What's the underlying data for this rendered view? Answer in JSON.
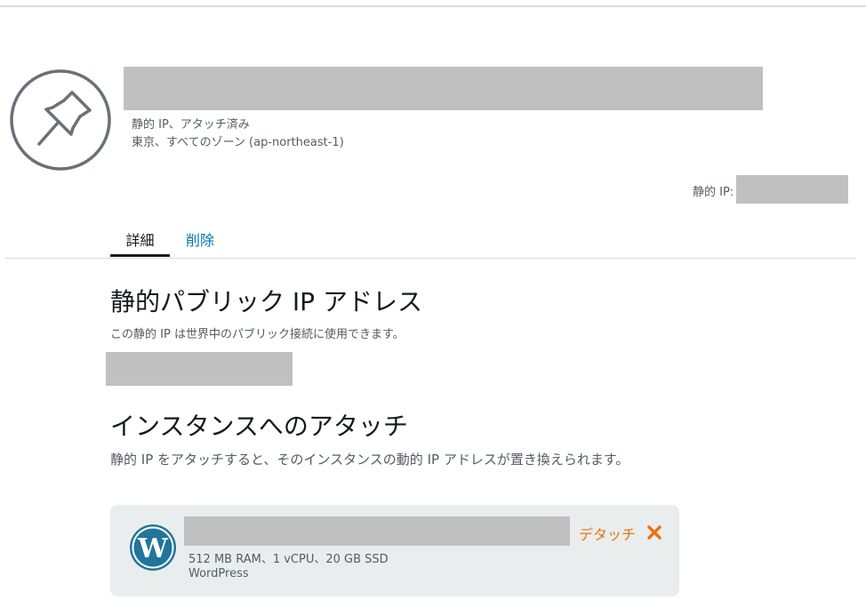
{
  "header": {
    "resource_type": "静的 IP、アタッチ済み",
    "region": "東京、すべてのゾーン (ap-northeast-1)",
    "static_ip_label": "静的 IP:"
  },
  "tabs": [
    {
      "label": "詳細",
      "active": true
    },
    {
      "label": "削除",
      "active": false
    }
  ],
  "public_ip_section": {
    "title": "静的パブリック IP アドレス",
    "description": "この静的 IP は世界中のパブリック接続に使用できます。"
  },
  "attach_section": {
    "title": "インスタンスへのアタッチ",
    "description": "静的 IP をアタッチすると、そのインスタンスの動的 IP アドレスが置き換えられます。"
  },
  "attached_instance": {
    "spec": "512 MB RAM、1 vCPU、20 GB SSD",
    "blueprint": "WordPress",
    "detach_label": "デタッチ"
  },
  "icons": {
    "header_icon": "pushpin-icon",
    "instance_icon": "wordpress-icon",
    "detach_icon": "close-icon"
  },
  "colors": {
    "link": "#0073bb",
    "detach": "#ec7211",
    "card_bg": "#eaeded",
    "redaction": "#c0c0c0",
    "wordpress": "#21759b"
  }
}
